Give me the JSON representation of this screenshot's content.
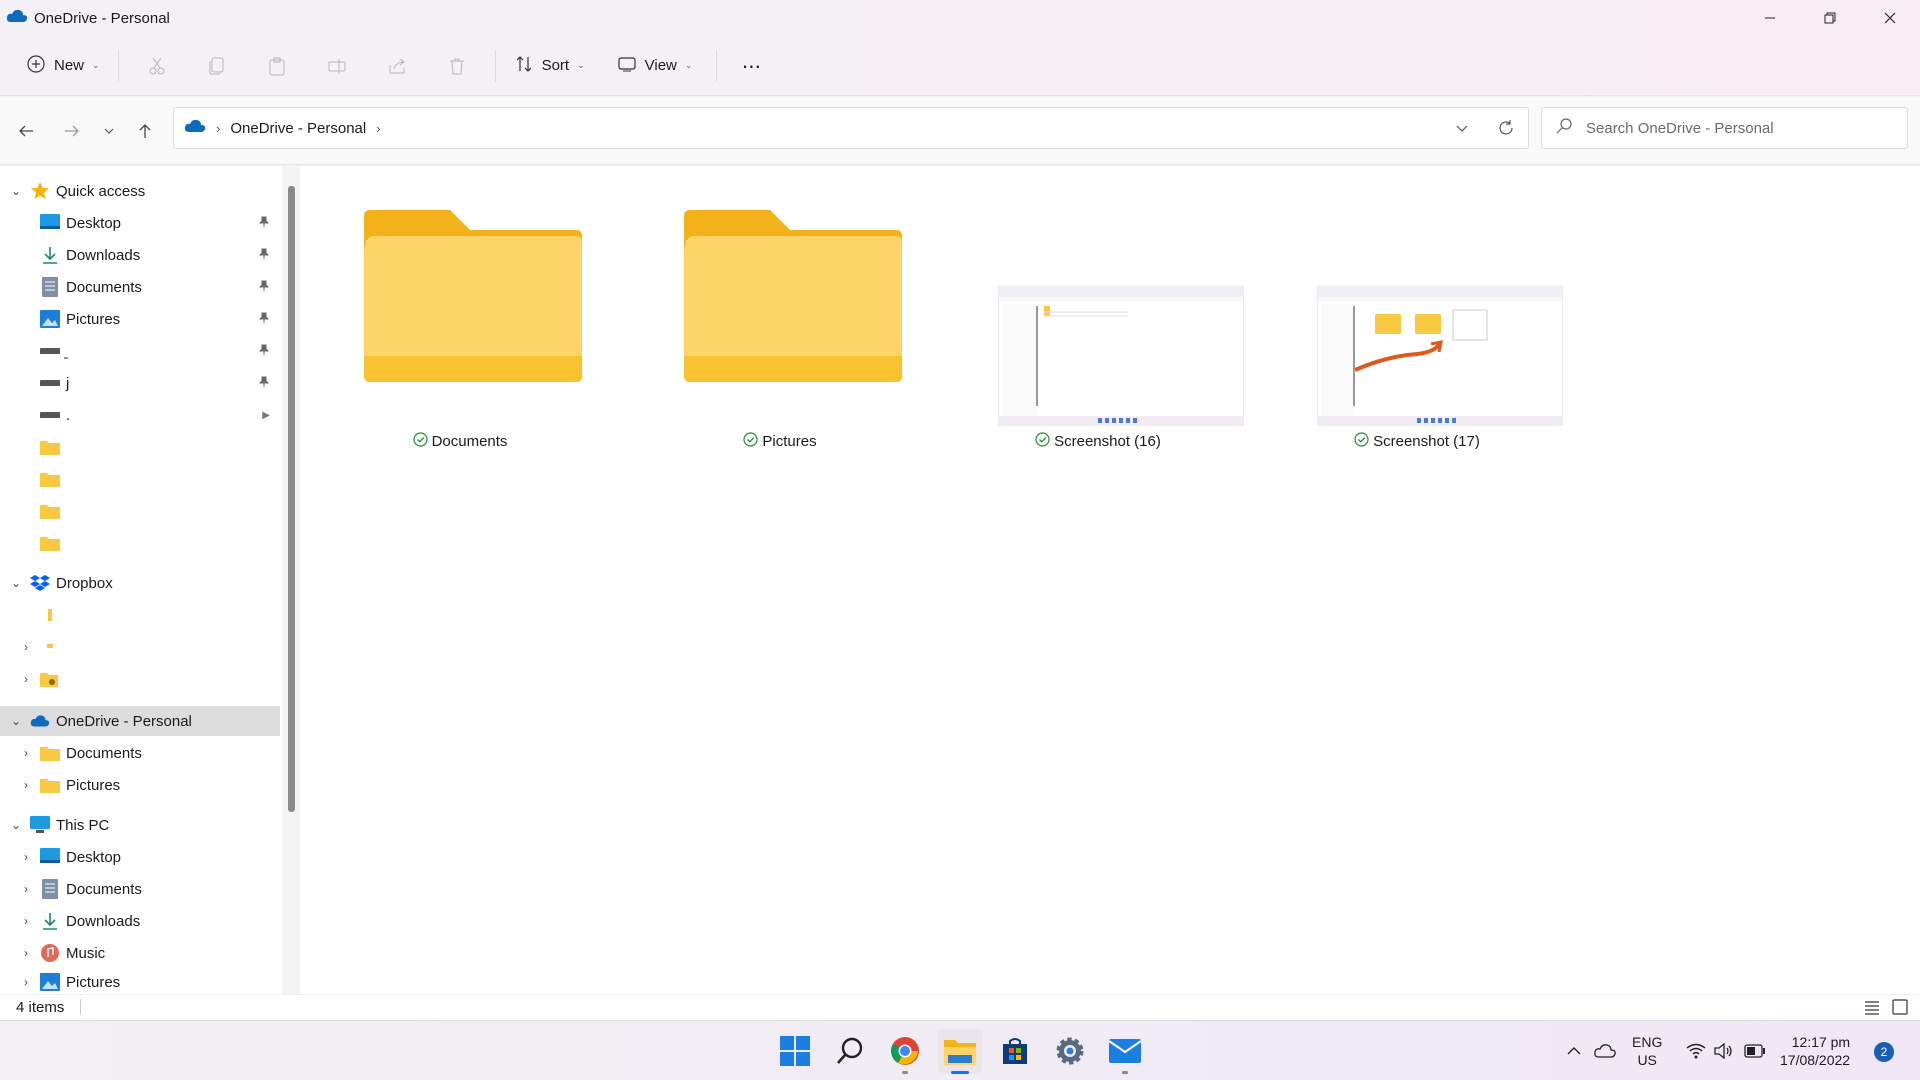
{
  "window": {
    "title": "OneDrive - Personal"
  },
  "toolbar": {
    "new_label": "New",
    "sort_label": "Sort",
    "view_label": "View",
    "more_label": "···"
  },
  "address": {
    "crumbs": [
      "OneDrive - Personal"
    ],
    "search_placeholder": "Search OneDrive - Personal"
  },
  "sidebar": {
    "quick_access": "Quick access",
    "quick_items": [
      "Desktop",
      "Downloads",
      "Documents",
      "Pictures",
      "̱",
      "j",
      "."
    ],
    "dropbox": "Dropbox",
    "onedrive": "OneDrive - Personal",
    "onedrive_items": [
      "Documents",
      "Pictures"
    ],
    "this_pc": "This PC",
    "pc_items": [
      "Desktop",
      "Documents",
      "Downloads",
      "Music",
      "Pictures"
    ]
  },
  "content": {
    "items": [
      {
        "name": "Documents",
        "type": "folder",
        "status": "synced"
      },
      {
        "name": "Pictures",
        "type": "folder",
        "status": "synced"
      },
      {
        "name": "Screenshot (16)",
        "type": "image",
        "status": "synced"
      },
      {
        "name": "Screenshot (17)",
        "type": "image",
        "status": "synced"
      }
    ]
  },
  "status": {
    "count": "4 items"
  },
  "taskbar": {
    "lang_top": "ENG",
    "lang_bottom": "US",
    "time": "12:17 pm",
    "date": "17/08/2022",
    "notifications": "2"
  },
  "colors": {
    "folder": "#f8c842",
    "accent": "#1a73e8",
    "onedrive": "#0f6cbd",
    "synced": "#1e8e3e"
  }
}
